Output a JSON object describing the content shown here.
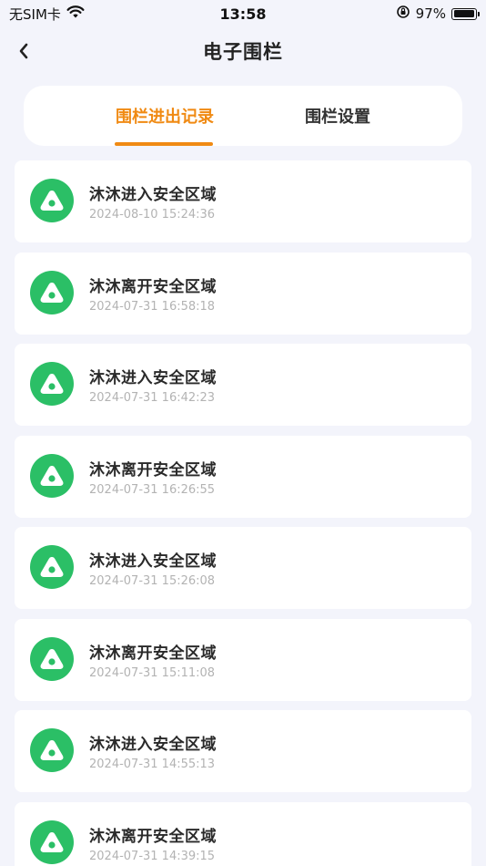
{
  "status_bar": {
    "carrier": "无SIM卡",
    "time": "13:58",
    "battery": "97%",
    "battery_level": 0.97
  },
  "header": {
    "title": "电子围栏"
  },
  "tabs": [
    {
      "label": "围栏进出记录",
      "active": true
    },
    {
      "label": "围栏设置",
      "active": false
    }
  ],
  "records": [
    {
      "title": "沐沐进入安全区域",
      "time": "2024-08-10 15:24:36"
    },
    {
      "title": "沐沐离开安全区域",
      "time": "2024-07-31 16:58:18"
    },
    {
      "title": "沐沐进入安全区域",
      "time": "2024-07-31 16:42:23"
    },
    {
      "title": "沐沐离开安全区域",
      "time": "2024-07-31 16:26:55"
    },
    {
      "title": "沐沐进入安全区域",
      "time": "2024-07-31 15:26:08"
    },
    {
      "title": "沐沐离开安全区域",
      "time": "2024-07-31 15:11:08"
    },
    {
      "title": "沐沐进入安全区域",
      "time": "2024-07-31 14:55:13"
    },
    {
      "title": "沐沐离开安全区域",
      "time": "2024-07-31 14:39:15"
    }
  ],
  "colors": {
    "accent": "#f08a13",
    "icon_green": "#2bbf66",
    "background": "#f3f4fb"
  },
  "icons": {
    "back": "chevron-left-icon",
    "record": "fence-location-icon",
    "wifi": "wifi-icon",
    "orientation_lock": "orientation-lock-icon",
    "battery": "battery-icon"
  }
}
